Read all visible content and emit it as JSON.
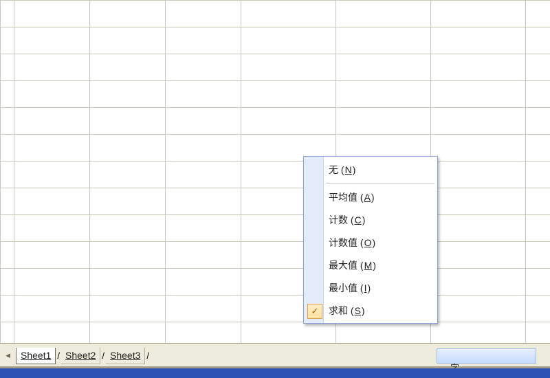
{
  "sheet_tabs": {
    "nav_glyph": "◂",
    "tabs": [
      {
        "label": "Sheet1",
        "active": true
      },
      {
        "label": "Sheet2",
        "active": false
      },
      {
        "label": "Sheet3",
        "active": false
      }
    ],
    "trail": "/"
  },
  "context_menu": {
    "items": [
      {
        "label": "无",
        "accel": "N",
        "checked": false,
        "sep_after": true
      },
      {
        "label": "平均值",
        "accel": "A",
        "checked": false,
        "sep_after": false
      },
      {
        "label": "计数",
        "accel": "C",
        "checked": false,
        "sep_after": false
      },
      {
        "label": "计数值",
        "accel": "O",
        "checked": false,
        "sep_after": false
      },
      {
        "label": "最大值",
        "accel": "M",
        "checked": false,
        "sep_after": false
      },
      {
        "label": "最小值",
        "accel": "I",
        "checked": false,
        "sep_after": false
      },
      {
        "label": "求和",
        "accel": "S",
        "checked": true,
        "sep_after": false
      }
    ]
  },
  "status_fragment": "字"
}
